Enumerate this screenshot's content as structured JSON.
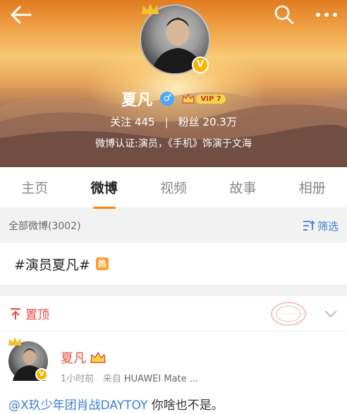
{
  "profile": {
    "name": "夏凡",
    "gender_symbol": "♂",
    "vip_label": "VIP 7",
    "verified_symbol": "V",
    "following_label": "关注",
    "following_count": "445",
    "separator": "|",
    "fans_label": "粉丝",
    "fans_count": "20.3万",
    "certification": "微博认证:演员，《手机》饰演于文海"
  },
  "tabs": [
    {
      "label": "主页",
      "active": false
    },
    {
      "label": "微博",
      "active": true
    },
    {
      "label": "视频",
      "active": false
    },
    {
      "label": "故事",
      "active": false
    },
    {
      "label": "相册",
      "active": false
    }
  ],
  "filter_bar": {
    "count_label": "全部微博(3002)",
    "filter_label": "筛选"
  },
  "topic": {
    "text": "#演员夏凡#",
    "hot_badge": "热"
  },
  "pinned": {
    "label": "置顶"
  },
  "post": {
    "author": "夏凡",
    "time": "1小时前",
    "source_prefix": "来自",
    "source": "HUAWEI Mate ...",
    "mention": "@X玖少年团肖战DAYTOY",
    "text": " 你啥也不是。"
  },
  "colors": {
    "accent": "#ff8200",
    "mention": "#3d7bd6",
    "pinned": "#e8473c",
    "verified": "#f6b400"
  },
  "icons": [
    "back-icon",
    "search-icon",
    "more-icon",
    "crown-icon",
    "verified-icon",
    "filter-icon",
    "pin-top-icon",
    "chevron-down-icon"
  ]
}
